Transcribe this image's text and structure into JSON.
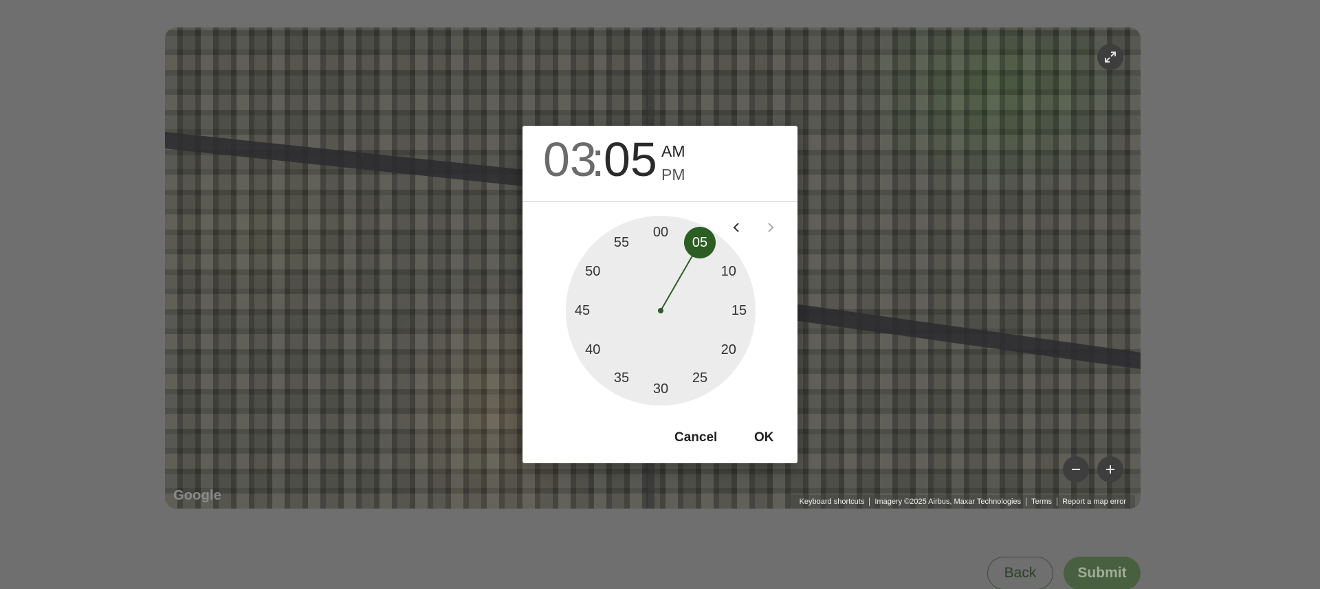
{
  "map": {
    "logo": "Google",
    "attribution": [
      "Keyboard shortcuts",
      "Imagery ©2025 Airbus, Maxar Technologies",
      "Terms",
      "Report a map error"
    ],
    "icons": {
      "fullscreen": "expand-icon",
      "zoom_out": "minus-icon",
      "zoom_in": "plus-icon"
    }
  },
  "time_picker": {
    "hour": "03",
    "separator": ":",
    "minute": "05",
    "am_label": "AM",
    "pm_label": "PM",
    "selected_period": "AM",
    "clock_labels": [
      "00",
      "05",
      "10",
      "15",
      "20",
      "25",
      "30",
      "35",
      "40",
      "45",
      "50",
      "55"
    ],
    "selected_minute": "05",
    "cancel_label": "Cancel",
    "ok_label": "OK",
    "accent_color": "#2c5e24"
  },
  "form": {
    "back_label": "Back",
    "submit_label": "Submit"
  }
}
